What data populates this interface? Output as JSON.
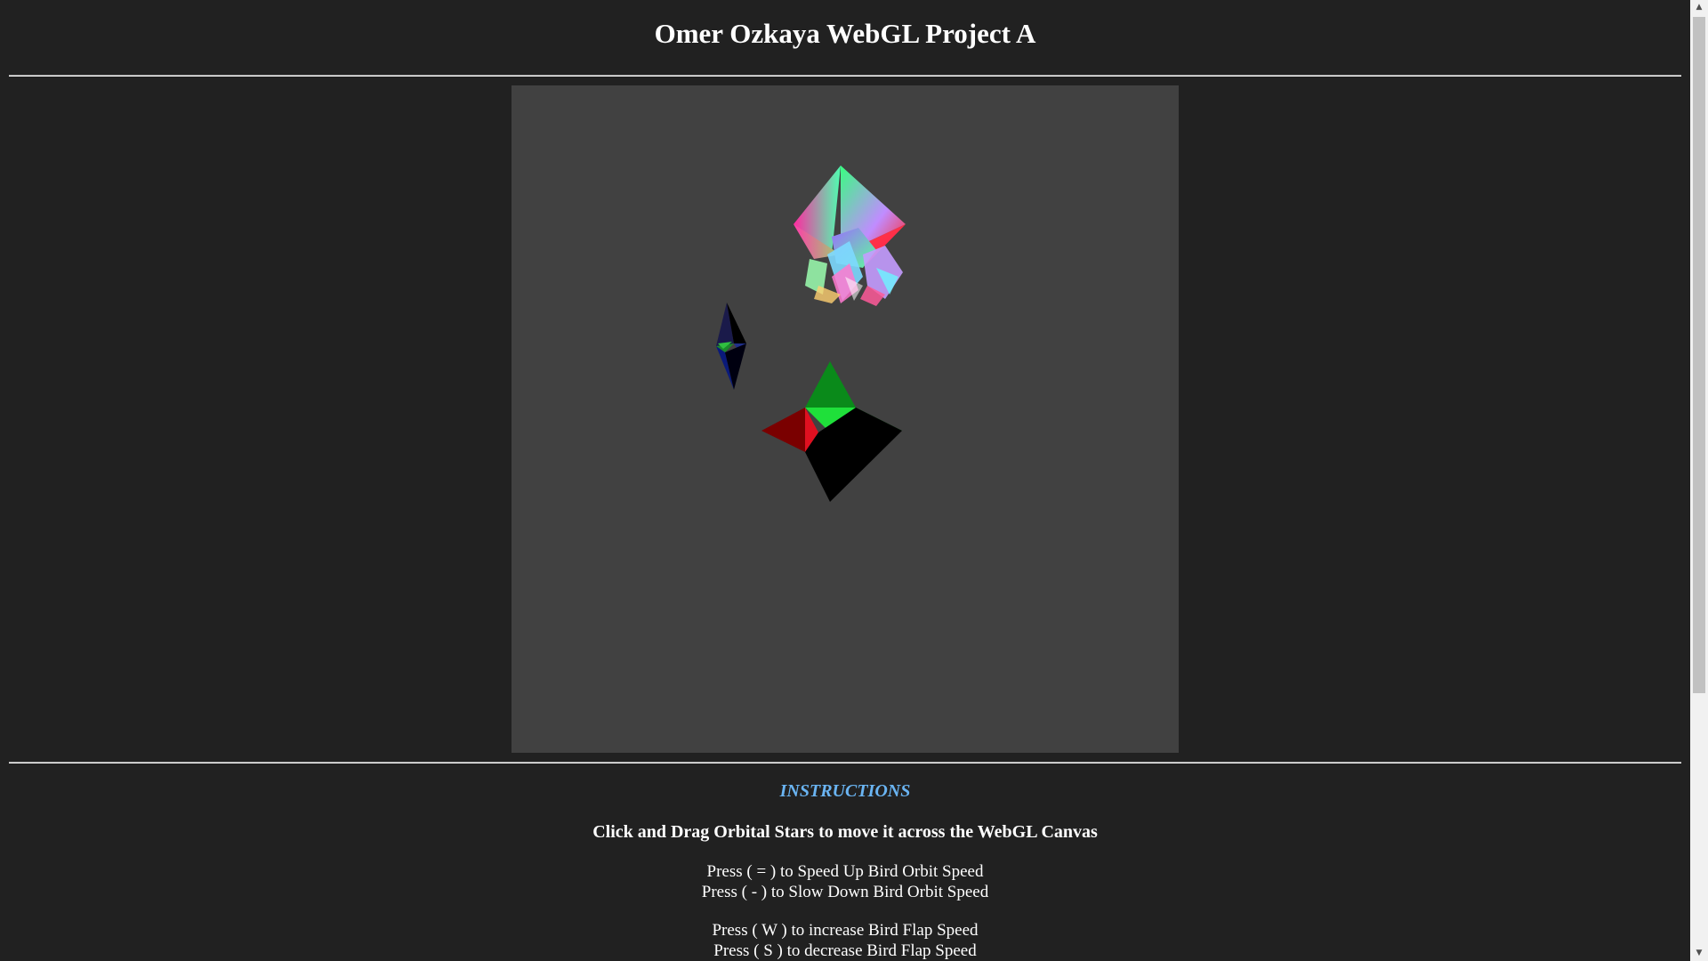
{
  "page": {
    "title": "Omer Ozkaya WebGL Project A"
  },
  "instructions": {
    "heading": "INSTRUCTIONS",
    "drag_hint": "Click and Drag Orbital Stars to move it across the WebGL Canvas",
    "lines": [
      "Press ( = ) to Speed Up Bird Orbit Speed",
      "Press ( - ) to Slow Down Bird Orbit Speed",
      "Press ( W ) to increase Bird Flap Speed",
      "Press ( S ) to decrease Bird Flap Speed"
    ]
  },
  "colors": {
    "page_background": "#212121",
    "canvas_background": "#414141",
    "heading_accent": "#6ab4f2",
    "text": "#ffffff"
  },
  "icons": {
    "scroll_up": "scroll-up-arrow-icon",
    "scroll_down": "scroll-down-arrow-icon"
  }
}
